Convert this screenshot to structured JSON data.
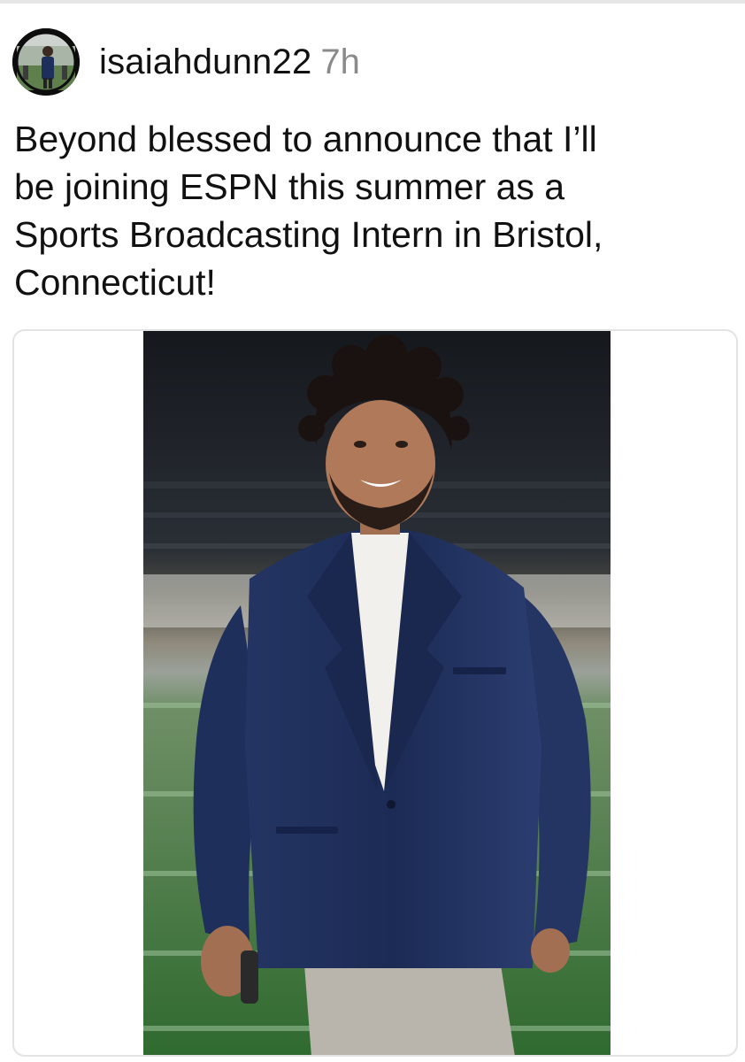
{
  "post": {
    "username": "isaiahdunn22",
    "timestamp": "7h",
    "caption": "Beyond blessed to announce that I’ll\nbe joining ESPN this summer as a\nSports Broadcasting Intern in Bristol,\nConnecticut!"
  },
  "avatar": {
    "icon": "profile-photo"
  },
  "media": {
    "icon": "person-in-navy-suit-on-football-field-photo",
    "colors": {
      "suit": "#1f2f5c",
      "field": "#3f7a3c",
      "stadium": "#1a1d22",
      "shirt": "#f2f0ec",
      "hair": "#1a1210",
      "skin": "#b07a5a",
      "pants": "#b9b5ad"
    }
  }
}
